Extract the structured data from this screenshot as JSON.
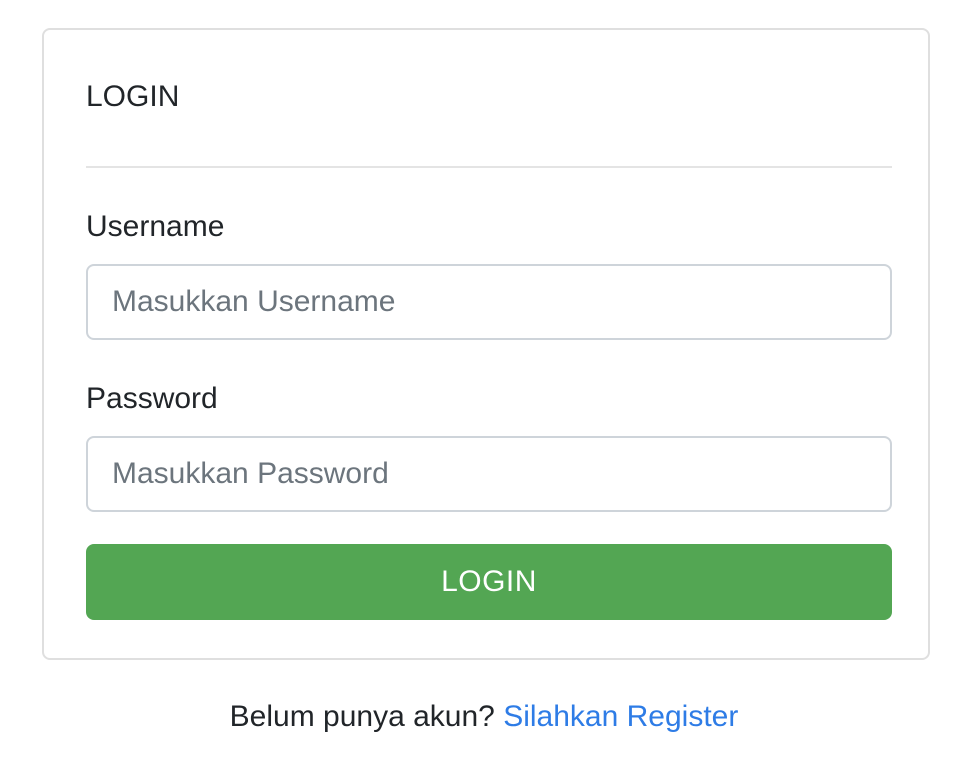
{
  "login_card": {
    "title": "LOGIN",
    "username": {
      "label": "Username",
      "placeholder": "Masukkan Username",
      "value": ""
    },
    "password": {
      "label": "Password",
      "placeholder": "Masukkan Password",
      "value": ""
    },
    "submit_label": "LOGIN"
  },
  "footer": {
    "prompt_text": "Belum punya akun?",
    "register_link_text": "Silahkan Register"
  },
  "colors": {
    "button_bg": "#53a653",
    "link": "#2e7ce6",
    "border": "#dfdfdf"
  }
}
